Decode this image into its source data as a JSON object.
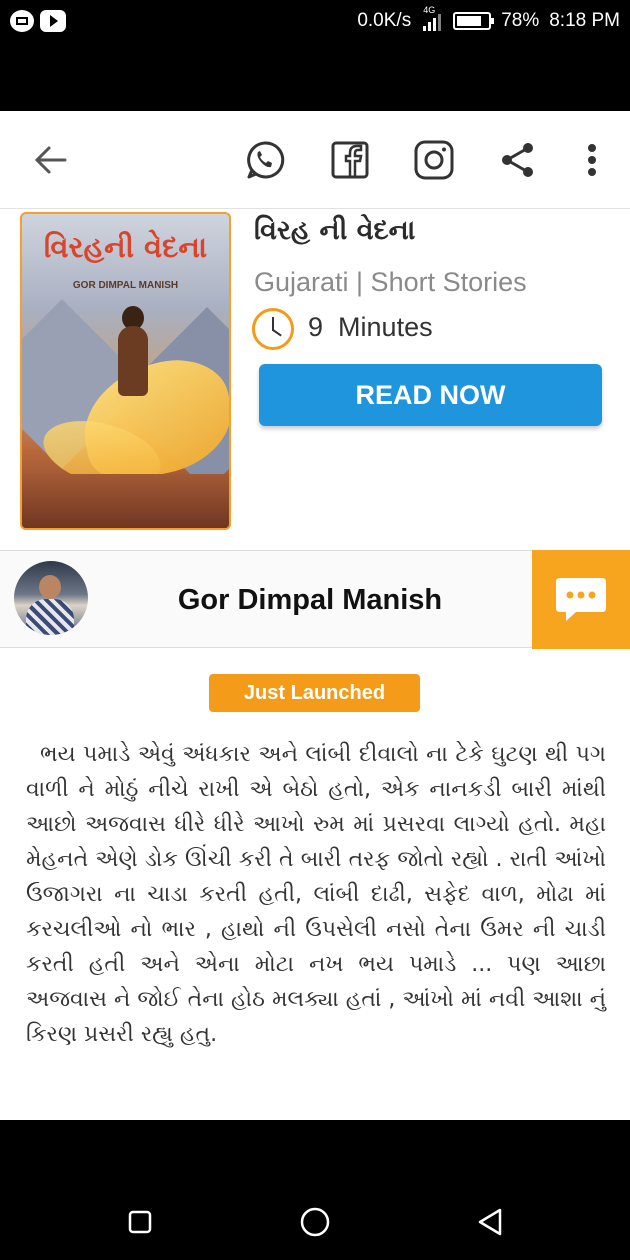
{
  "status_bar": {
    "net_speed": "0.0K/s",
    "network_type": "4G",
    "battery": "78%",
    "time": "8:18 PM"
  },
  "toolbar": {
    "icons": [
      "back-arrow-icon",
      "whatsapp-icon",
      "facebook-icon",
      "instagram-icon",
      "share-icon",
      "more-vert-icon"
    ]
  },
  "book": {
    "cover_title": "વિરહની વેદના",
    "cover_author": "GOR DIMPAL MANISH",
    "title": "વિરહ ની વેદના",
    "category": "Gujarati | Short Stories",
    "duration_value": "9",
    "duration_unit": "Minutes",
    "read_button": "READ NOW"
  },
  "author": {
    "name": "Gor Dimpal Manish"
  },
  "badge": "Just Launched",
  "story_excerpt": "ભય પમાડે એવું અંધકાર અને લાંબી દીવાલો ના ટેકે ઘુટણ થી પગ વાળી ને મોઠું નીચે રાખી એ બેઠો હતો, એક નાનકડી બારી માંથી આછો અજવાસ ધીરે ધીરે આખો રુમ માં પ્રસરવા લાગ્યો હતો. મહા મેહનતે એણે ડોક ઊંચી કરી તે બારી તરફ જોતો રહ્યો . રાતી આંખો ઉજાગરા ના ચાડા કરતી હતી, લાંબી દાઢી, સફેદ વાળ, મોઢા માં કરચલીઓ નો ભાર , હાથો ની ઉપસેલી નસો તેના ઉમર ની ચાડી કરતી હતી અને એના મોટા નખ ભય પમાડે ... પણ આછા અજવાસ ને જોઈ તેના હોઠ મલક્યા હતાં , આંખો માં નવી આશા નું કિરણ પ્રસરી રહ્યુ હતુ.",
  "colors": {
    "accent_orange": "#f59b1a",
    "read_button_blue": "#1e95dc"
  }
}
